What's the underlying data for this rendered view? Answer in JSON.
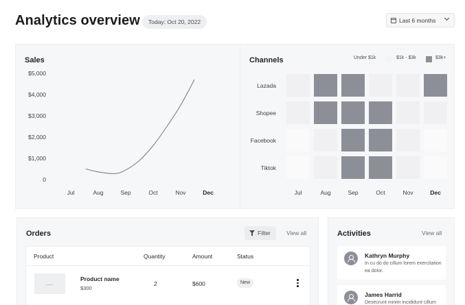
{
  "header": {
    "title": "Analytics overview",
    "today": "Today: Oct 20, 2022",
    "range": "Last 6 months"
  },
  "sales": {
    "title": "Sales",
    "chart_data": {
      "type": "line",
      "title": "Sales",
      "x": [
        "Jul",
        "Aug",
        "Sep",
        "Oct",
        "Nov",
        "Dec"
      ],
      "y_ticks": [
        "$5,000",
        "$4,000",
        "$3,000",
        "$2,000",
        "$1,000",
        "0"
      ],
      "ylim": [
        0,
        5000
      ],
      "x_bold": "Dec",
      "grid": false,
      "series": [
        {
          "points": [
            [
              0.55,
              500
            ],
            [
              1.0,
              360
            ],
            [
              1.6,
              280
            ],
            [
              2.0,
              450
            ],
            [
              2.5,
              900
            ],
            [
              3.0,
              1600
            ],
            [
              3.5,
              2500
            ],
            [
              4.0,
              3500
            ],
            [
              4.5,
              4700
            ]
          ]
        }
      ]
    }
  },
  "channels": {
    "title": "Channels",
    "legend": [
      "Under $1k",
      "$1k - $3k",
      "$3k+"
    ],
    "chart_data": {
      "type": "heatmap",
      "title": "Channels",
      "rows": [
        "Lazada",
        "Shopee",
        "Facebook",
        "Tiktok"
      ],
      "columns": [
        "Jul",
        "Aug",
        "Sep",
        "Oct",
        "Nov",
        "Dec"
      ],
      "x_bold": "Dec",
      "levels": [
        "Under $1k",
        "$1k - $3k",
        "$3k+"
      ],
      "values": [
        [
          2,
          3,
          3,
          2,
          2,
          3
        ],
        [
          2,
          3,
          3,
          3,
          2,
          2
        ],
        [
          1,
          2,
          3,
          3,
          2,
          1
        ],
        [
          1,
          2,
          3,
          3,
          2,
          1
        ]
      ]
    }
  },
  "orders": {
    "title": "Orders",
    "filter_label": "Filter",
    "view_all": "View all",
    "columns": [
      "Product",
      "Quantity",
      "Amount",
      "Status"
    ],
    "rows": [
      {
        "name": "Product name",
        "price": "$300",
        "quantity": "2",
        "amount": "$600",
        "status": "New"
      }
    ]
  },
  "activities": {
    "title": "Activities",
    "view_all": "View all",
    "items": [
      {
        "name": "Kathryn Murphy",
        "text": "In cu do do cillum lorem exercitation ea dolor."
      },
      {
        "name": "James Harrid",
        "text": "Desecrunt minim incididunt cillum"
      }
    ]
  },
  "colors": {
    "high": "#8d8f98",
    "mid": "#f0f0f2",
    "low": "#fafafb",
    "card": "#f6f7f8"
  }
}
